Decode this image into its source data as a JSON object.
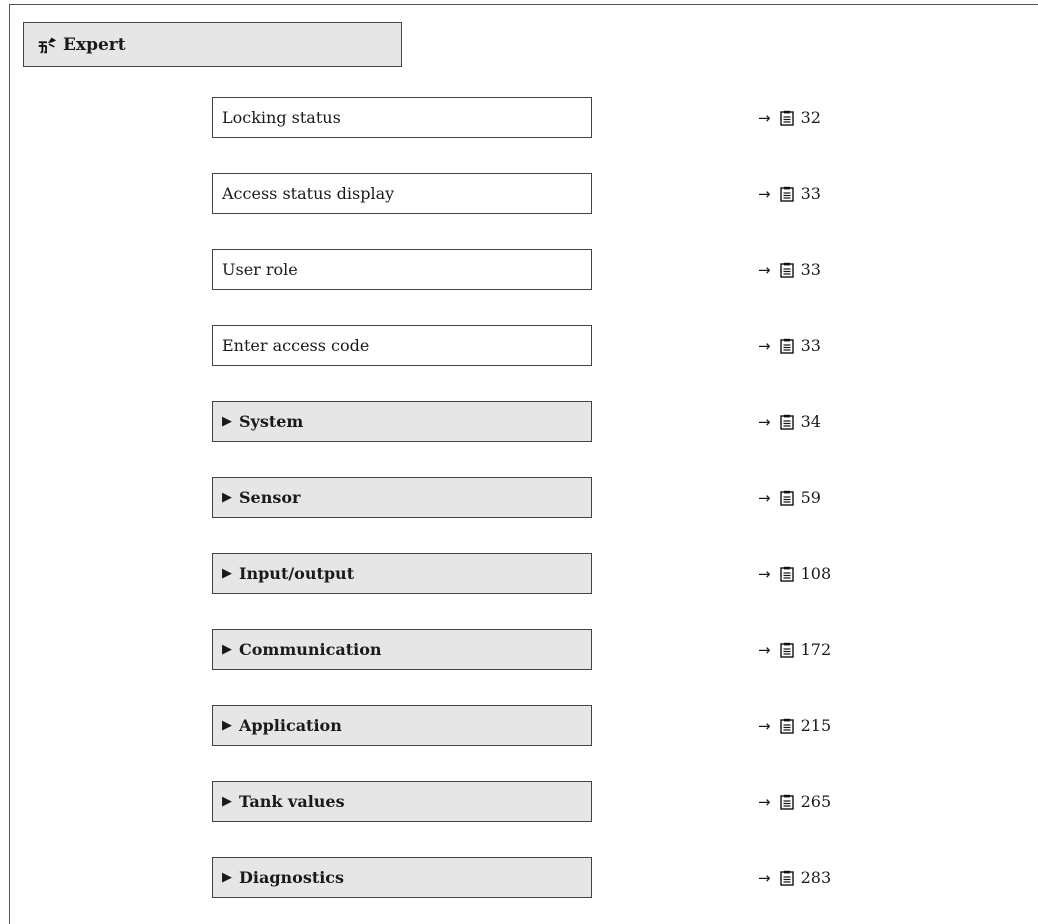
{
  "header": {
    "title": "Expert",
    "icon": "expert-wizard-icon"
  },
  "items": [
    {
      "label": "Locking status",
      "submenu": false,
      "page": "32"
    },
    {
      "label": "Access status display",
      "submenu": false,
      "page": "33"
    },
    {
      "label": "User role",
      "submenu": false,
      "page": "33"
    },
    {
      "label": "Enter access code",
      "submenu": false,
      "page": "33"
    },
    {
      "label": "System",
      "submenu": true,
      "page": "34"
    },
    {
      "label": "Sensor",
      "submenu": true,
      "page": "59"
    },
    {
      "label": "Input/output",
      "submenu": true,
      "page": "108"
    },
    {
      "label": "Communication",
      "submenu": true,
      "page": "172"
    },
    {
      "label": "Application",
      "submenu": true,
      "page": "215"
    },
    {
      "label": "Tank values",
      "submenu": true,
      "page": "265"
    },
    {
      "label": "Diagnostics",
      "submenu": true,
      "page": "283"
    }
  ],
  "colors": {
    "submenu_bg": "#e6e6e6",
    "border": "#444444"
  }
}
